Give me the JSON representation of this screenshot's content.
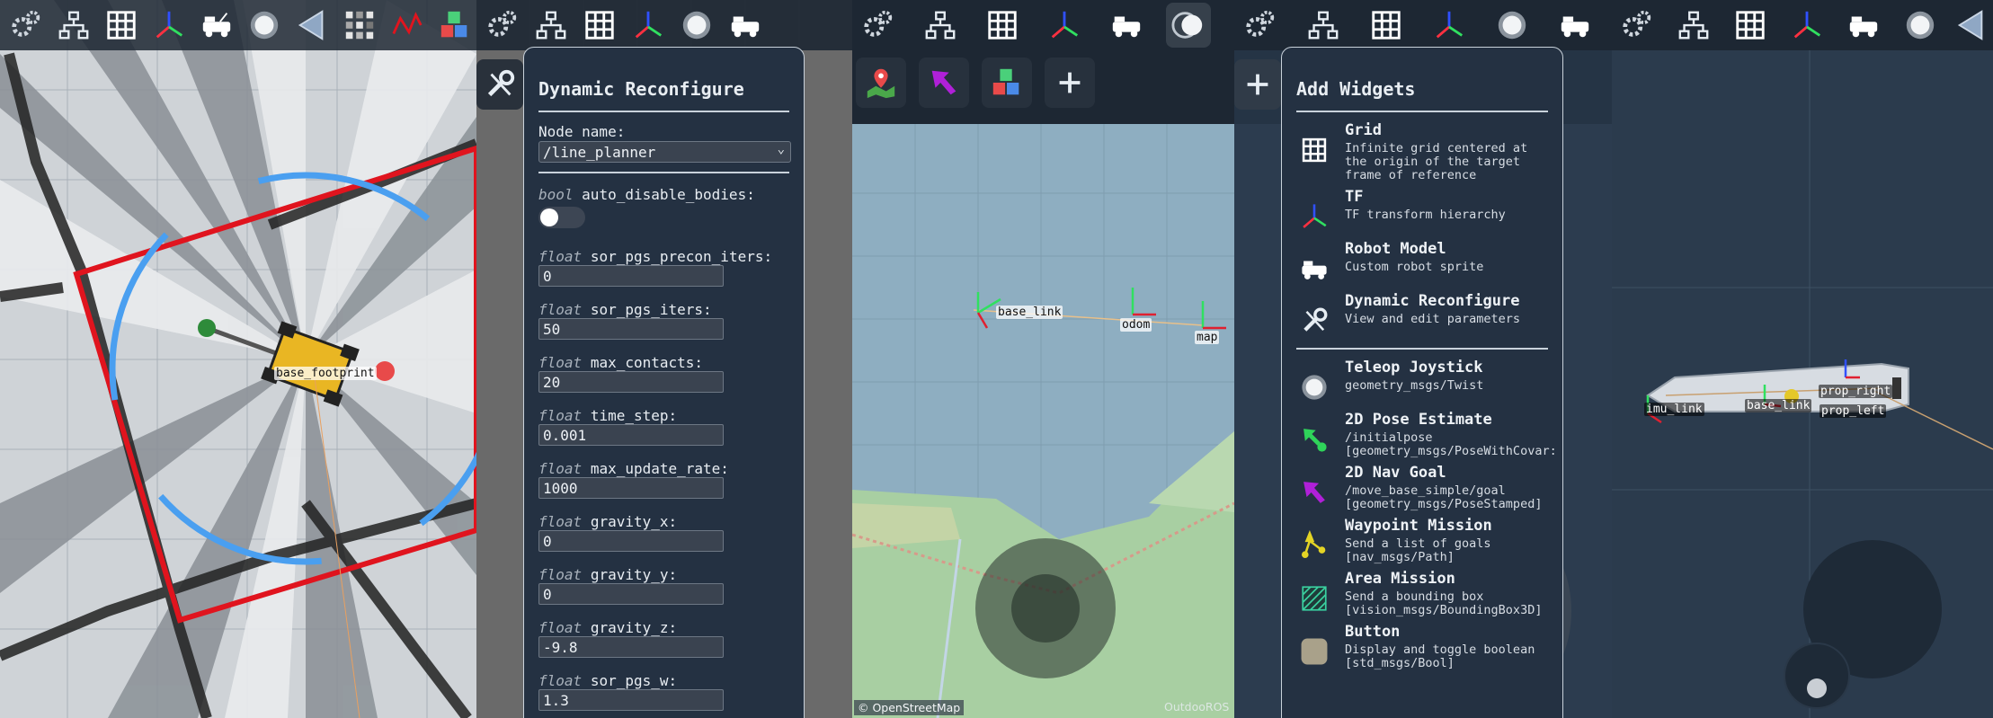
{
  "toolbar_icons": [
    "gear-icon",
    "tree-icon",
    "grid-icon",
    "axes-icon",
    "robot-icon",
    "joystick-icon",
    "cone-icon",
    "costmap-icon",
    "path-icon",
    "cube-icon"
  ],
  "panel1": {
    "frame_label": "base_footprint"
  },
  "panel2": {
    "dialog_title": "Dynamic Reconfigure",
    "node_name_label": "Node name:",
    "node_name_value": "/line_planner",
    "bool_param": {
      "type": "bool",
      "name": "auto_disable_bodies:",
      "value": false
    },
    "params": [
      {
        "type": "float",
        "name": "sor_pgs_precon_iters:",
        "value": "0"
      },
      {
        "type": "float",
        "name": "sor_pgs_iters:",
        "value": "50"
      },
      {
        "type": "float",
        "name": "max_contacts:",
        "value": "20"
      },
      {
        "type": "float",
        "name": "time_step:",
        "value": "0.001"
      },
      {
        "type": "float",
        "name": "max_update_rate:",
        "value": "1000"
      },
      {
        "type": "float",
        "name": "gravity_x:",
        "value": "0"
      },
      {
        "type": "float",
        "name": "gravity_y:",
        "value": "0"
      },
      {
        "type": "float",
        "name": "gravity_z:",
        "value": "-9.8"
      },
      {
        "type": "float",
        "name": "sor_pgs_w:",
        "value": "1.3"
      }
    ]
  },
  "panel3": {
    "labels": {
      "base_link": "base_link",
      "odom": "odom",
      "map": "map"
    },
    "attribution": "© OpenStreetMap",
    "watermark": "OutdooROS"
  },
  "panel4": {
    "dialog_title": "Add Widgets",
    "widgets_a": [
      {
        "icon": "grid-icon",
        "name": "Grid",
        "desc": "Infinite grid centered at\nthe origin of the target\nframe of reference"
      },
      {
        "icon": "axes-icon",
        "name": "TF",
        "desc": "TF transform hierarchy"
      },
      {
        "icon": "robot-icon",
        "name": "Robot Model",
        "desc": "Custom robot sprite"
      },
      {
        "icon": "wrench-icon",
        "name": "Dynamic Reconfigure",
        "desc": "View and edit parameters"
      }
    ],
    "widgets_b": [
      {
        "icon": "joystick-icon",
        "name": "Teleop Joystick",
        "desc": "geometry_msgs/Twist"
      },
      {
        "icon": "pose-estimate-icon",
        "name": "2D Pose Estimate",
        "desc": "/initialpose\n[geometry_msgs/PoseWithCovar:"
      },
      {
        "icon": "nav-goal-icon",
        "name": "2D Nav Goal",
        "desc": "/move_base_simple/goal\n[geometry_msgs/PoseStamped]"
      },
      {
        "icon": "waypoint-icon",
        "name": "Waypoint Mission",
        "desc": "Send a list of goals\n[nav_msgs/Path]"
      },
      {
        "icon": "area-icon",
        "name": "Area Mission",
        "desc": "Send a bounding box\n[vision_msgs/BoundingBox3D]"
      },
      {
        "icon": "button-icon",
        "name": "Button",
        "desc": "Display and toggle boolean\n[std_msgs/Bool]"
      }
    ]
  },
  "panel5": {
    "labels": {
      "imu_link": "imu_link",
      "base_link": "base_link",
      "prop_right": "prop_right",
      "prop_left": "prop_left"
    }
  },
  "colors": {
    "toolbar_bg": "#1d2733",
    "dialog_bg": "#243142",
    "costmap_red": "#e0141e",
    "footprint_blue": "#4a9ff0",
    "map_water": "#8eaec1",
    "map_land": "#a8cfa2",
    "nav_goal_purple": "#b020d8",
    "pose_green": "#2fd45a",
    "waypoint_yellow": "#e4d425"
  }
}
